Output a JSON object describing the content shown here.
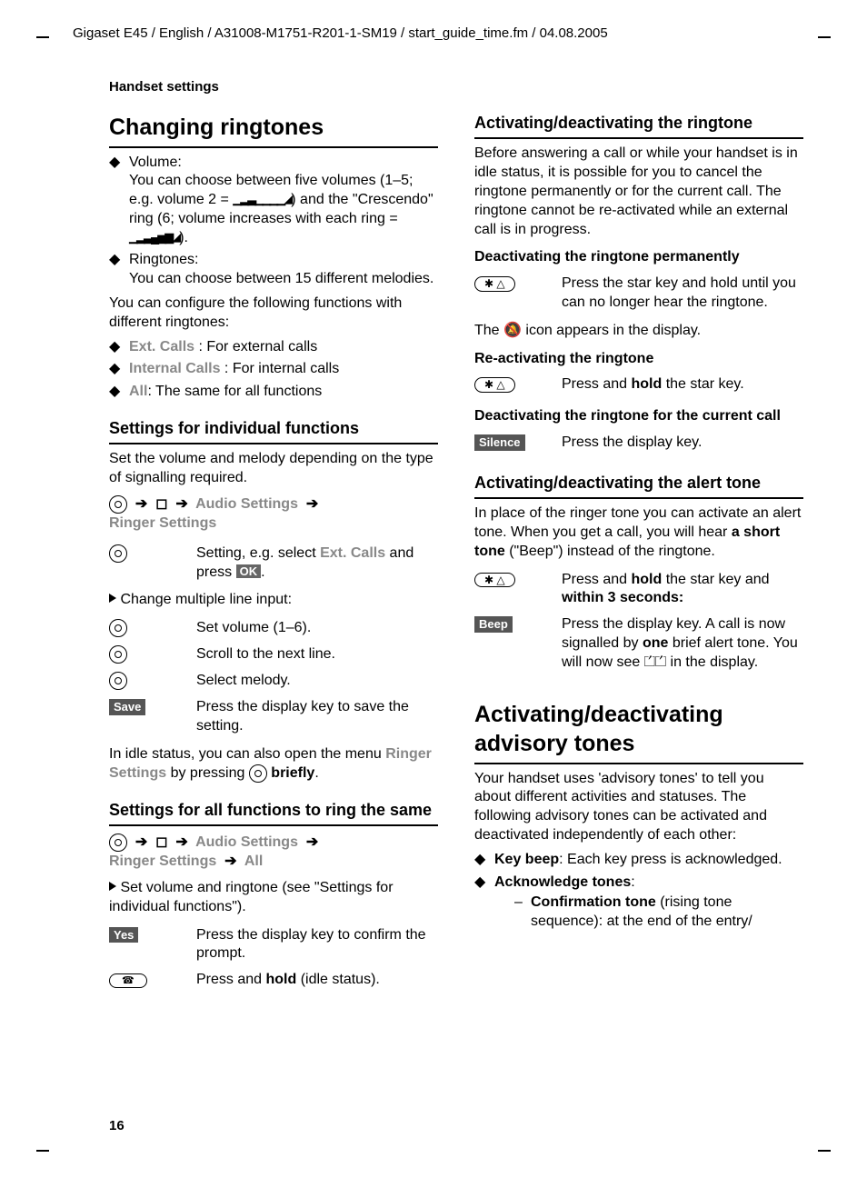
{
  "running_head": "Gigaset E45 / English / A31008-M1751-R201-1-SM19 / start_guide_time.fm / 04.08.2005",
  "section_label": "Handset settings",
  "page_number": "16",
  "left": {
    "h1": "Changing ringtones",
    "volume_label": "Volume:",
    "volume_text_a": "You can choose between five volumes (1–5; e.g. volume 2 = ",
    "volume_text_b": ") and the \"Crescendo\" ring (6; volume increases with each ring = ",
    "volume_text_c": ").",
    "ringtones_label": "Ringtones:",
    "ringtones_text": "You can choose between 15 different melodies.",
    "config_intro": "You can configure the following functions with different ringtones:",
    "func_ext_label": "Ext. Calls",
    "func_ext_text": " : For external calls",
    "func_int_label": "Internal Calls",
    "func_int_text": " : For internal calls",
    "func_all_label": "All",
    "func_all_text": ": The same for all functions",
    "h2_individual": "Settings for individual functions",
    "individual_intro": "Set the volume and melody depending on the type of signalling required.",
    "menu_audio": "Audio Settings",
    "menu_ringer": "Ringer Settings",
    "row_setting_a": "Setting, e.g. select ",
    "row_setting_b": "Ext. Calls",
    "row_setting_c": " and press ",
    "row_setting_ok": "OK",
    "change_multi": "Change multiple line input:",
    "row_setvol": "Set volume (1–6).",
    "row_scroll": "Scroll to the next line.",
    "row_melody": "Select melody.",
    "row_save_key": "Save",
    "row_save_text": "Press the display key to save the setting.",
    "idle_a": "In idle status, you can also open the menu ",
    "idle_b": "Ringer Settings",
    "idle_c": " by pressing ",
    "idle_d": "briefly",
    "h2_allfunc": "Settings for all functions to ring the same",
    "menu_all": "All",
    "row_setvolring": "Set volume and ringtone (see \"Settings for individual functions\").",
    "row_yes_key": "Yes",
    "row_yes_text": "Press the display key to confirm the prompt.",
    "row_hang_a": "Press and ",
    "row_hang_b": "hold",
    "row_hang_c": " (idle status)."
  },
  "right": {
    "h2_actring": "Activating/deactivating the ringtone",
    "actring_text": "Before answering a call or while your handset is in idle status, it is possible for you to cancel the ringtone permanently or for the current call. The ringtone cannot be re-activated while an external call is in progress.",
    "h3_deact_perm": "Deactivating the ringtone permanently",
    "star_key": "✱ △",
    "deact_perm_text": "Press the star key and hold until you can no longer hear the ringtone.",
    "deact_icon_line_a": "The ",
    "deact_icon_line_b": " icon appears in the display.",
    "h3_react": "Re-activating the ringtone",
    "react_a": "Press and ",
    "react_b": "hold",
    "react_c": " the star key.",
    "h3_deact_cur": "Deactivating the ringtone for the current call",
    "silence_key": "Silence",
    "silence_text": "Press the display key.",
    "h2_alert": "Activating/deactivating the alert tone",
    "alert_intro_a": "In place of the ringer tone you can activate an alert tone. When you get a call, you will hear ",
    "alert_intro_b": "a short tone",
    "alert_intro_c": " (\"Beep\") instead of the ringtone.",
    "alert_star_a": "Press and ",
    "alert_star_b": "hold",
    "alert_star_c": " the star key and ",
    "alert_star_d": "within 3 seconds:",
    "beep_key": "Beep",
    "beep_a": "Press the display key. A call is now signalled by ",
    "beep_b": "one",
    "beep_c": " brief alert tone. You will now see ",
    "beep_d": " in the display.",
    "h1_advisory": "Activating/deactivating advisory tones",
    "adv_intro": "Your handset uses 'advisory tones' to tell you about different activities and statuses. The following advisory tones can be activated and deactivated independently of each other:",
    "kb_label": "Key beep",
    "kb_text": ": Each key press is acknowledged.",
    "ack_label": "Acknowledge tones",
    "conf_label": "Confirmation tone",
    "conf_text": " (rising tone sequence): at the end of the entry/"
  }
}
